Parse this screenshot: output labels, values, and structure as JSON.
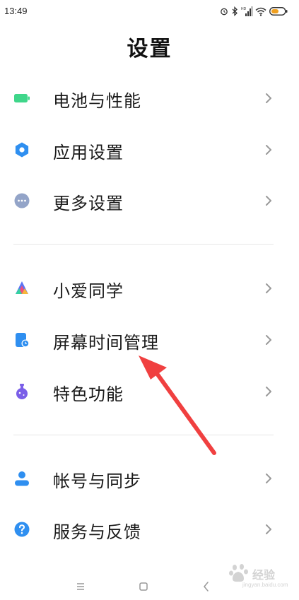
{
  "status_bar": {
    "time": "13:49",
    "icons": [
      "alarm-icon",
      "bluetooth-icon",
      "signal-icon",
      "wifi-icon",
      "battery-icon"
    ],
    "network_label": "HD"
  },
  "header": {
    "title": "设置"
  },
  "sections": [
    {
      "items": [
        {
          "label": "电池与性能",
          "icon": "battery-performance-icon",
          "icon_color": "#3fd68a"
        },
        {
          "label": "应用设置",
          "icon": "gear-icon",
          "icon_color": "#2f8ff0"
        },
        {
          "label": "更多设置",
          "icon": "more-dots-icon",
          "icon_color": "#93a4c8"
        }
      ]
    },
    {
      "items": [
        {
          "label": "小爱同学",
          "icon": "xiaoai-icon",
          "icon_color": "#5b74f5"
        },
        {
          "label": "屏幕时间管理",
          "icon": "screen-time-icon",
          "icon_color": "#2f8ff0"
        },
        {
          "label": "特色功能",
          "icon": "flask-icon",
          "icon_color": "#7a5ee8"
        }
      ]
    },
    {
      "items": [
        {
          "label": "帐号与同步",
          "icon": "account-icon",
          "icon_color": "#2f8ff0"
        },
        {
          "label": "服务与反馈",
          "icon": "help-icon",
          "icon_color": "#2f8ff0"
        }
      ]
    }
  ],
  "nav_bar": {
    "buttons": [
      "menu-icon",
      "home-icon",
      "back-icon"
    ]
  },
  "watermark": {
    "text": "经验",
    "url": "jingyan.baidu.com"
  },
  "annotation": {
    "arrow_color": "#f04040"
  }
}
